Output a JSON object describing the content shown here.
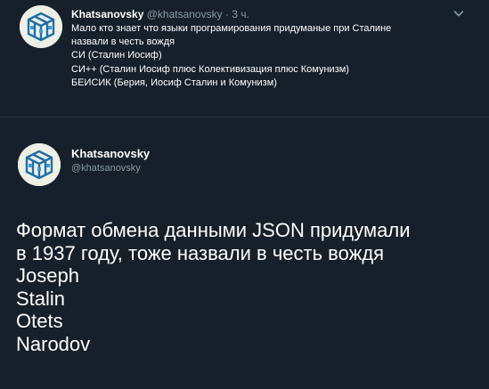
{
  "tweet_top": {
    "display_name": "Khatsanovsky",
    "handle": "@khatsanovsky",
    "separator": "·",
    "time": "3 ч.",
    "lines": [
      "Мало кто знает что языки програмирования придуманые при Сталине",
      "назвали в честь вождя",
      "СИ  (Сталин Иосиф)",
      "СИ++ (Сталин Иосиф плюс Колективизация плюс Комунизм)",
      "БЕИСИК (Берия, Иосиф Сталин и Комунизм)"
    ],
    "menu_icon": "chevron-down-icon"
  },
  "tweet_main": {
    "display_name": "Khatsanovsky",
    "handle": "@khatsanovsky",
    "lines": [
      "Формат обмена данными JSON придумали",
      "в 1937 году, тоже назвали в честь вождя",
      "Joseph",
      "Stalin",
      "Otets",
      "Narodov"
    ]
  },
  "colors": {
    "background": "#15202b",
    "text": "#ffffff",
    "secondary_text": "#8899a6",
    "divider": "#253341"
  }
}
